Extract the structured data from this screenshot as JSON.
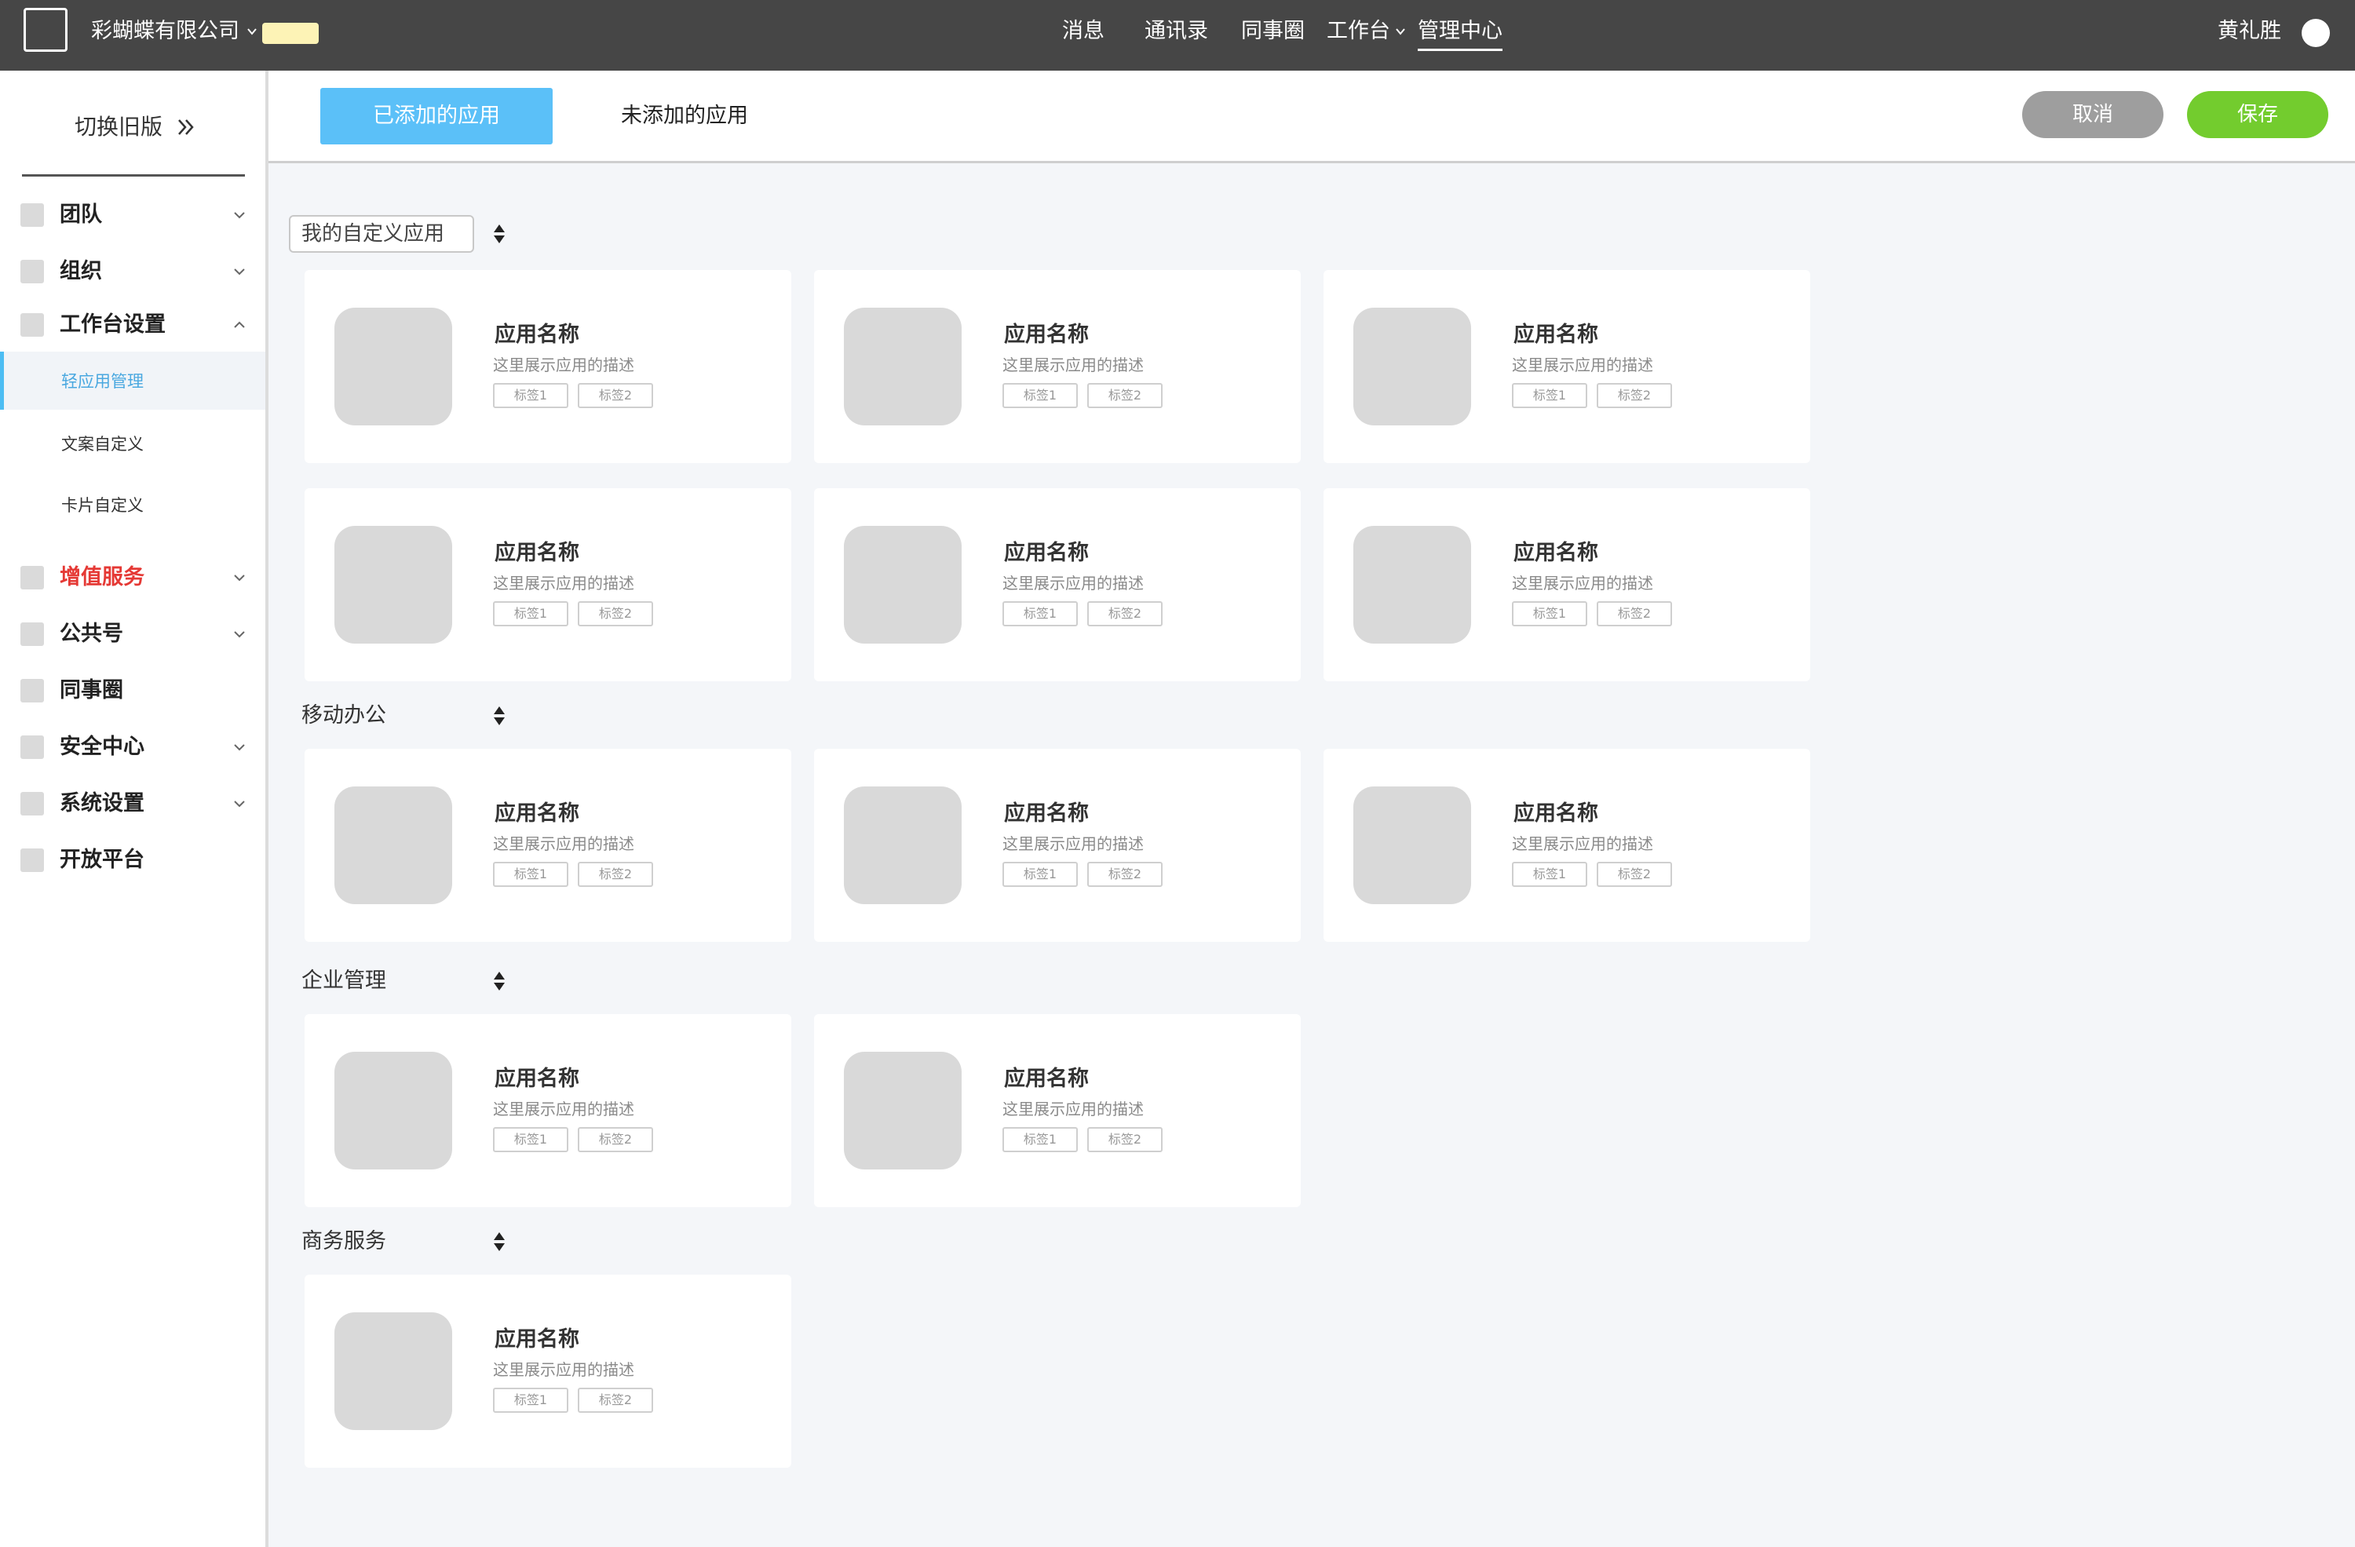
{
  "topbar": {
    "company": "彩蝴蝶有限公司",
    "nav": [
      "消息",
      "通讯录",
      "同事圈",
      "工作台",
      "管理中心"
    ],
    "active_nav": "管理中心",
    "user": "黄礼胜"
  },
  "sidebar": {
    "switch_old": "切换旧版",
    "items": [
      {
        "label": "团队",
        "expandable": true
      },
      {
        "label": "组织",
        "expandable": true
      },
      {
        "label": "工作台设置",
        "expanded": true
      },
      {
        "label": "增值服务",
        "expandable": true,
        "color": "#e53935"
      },
      {
        "label": "公共号",
        "expandable": true
      },
      {
        "label": "同事圈",
        "expandable": false
      },
      {
        "label": "安全中心",
        "expandable": true
      },
      {
        "label": "系统设置",
        "expandable": true
      },
      {
        "label": "开放平台",
        "expandable": false
      }
    ],
    "sub_items": [
      "轻应用管理",
      "文案自定义",
      "卡片自定义"
    ],
    "active_sub": "轻应用管理"
  },
  "header": {
    "tab_added": "已添加的应用",
    "tab_not_added": "未添加的应用",
    "cancel": "取消",
    "save": "保存"
  },
  "groups": [
    {
      "name": "我的自定义应用",
      "type": "select",
      "cards": 6
    },
    {
      "name": "移动办公",
      "cards": 3
    },
    {
      "name": "企业管理",
      "cards": 2
    },
    {
      "name": "商务服务",
      "cards": 1
    }
  ],
  "card": {
    "name": "应用名称",
    "desc": "这里展示应用的描述",
    "tag1": "标签1",
    "tag2": "标签2"
  },
  "colors": {
    "topbar": "#464646",
    "accent": "#5bc0f8",
    "save": "#73cc2e",
    "cancel": "#9e9e9e",
    "warning": "#e53935"
  }
}
